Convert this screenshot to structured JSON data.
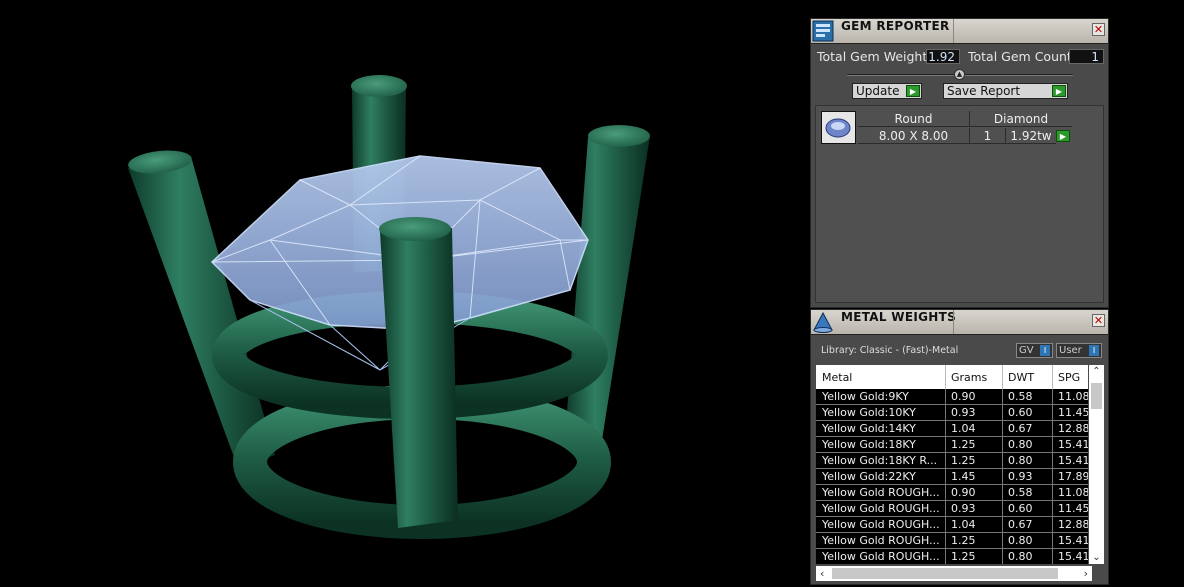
{
  "gem_reporter": {
    "title": "GEM REPORTER",
    "close": "✕",
    "total_weight_label": "Total Gem Weight",
    "total_weight_value": "1.92",
    "total_count_label": "Total Gem Count",
    "total_count_value": "1",
    "update_label": "Update",
    "save_label": "Save Report",
    "gem": {
      "shape": "Round",
      "material": "Diamond",
      "size": "8.00 X 8.00",
      "count": "1",
      "weight": "1.92tw"
    }
  },
  "metal_weights": {
    "title": "METAL WEIGHTS",
    "close": "✕",
    "library": "Library: Classic - (Fast)-Metal",
    "toggle_gv": "GV",
    "toggle_user": "User",
    "columns": [
      "Metal",
      "Grams",
      "DWT",
      "SPG"
    ],
    "rows": [
      [
        "Yellow Gold:9KY",
        "0.90",
        "0.58",
        "11.08"
      ],
      [
        "Yellow Gold:10KY",
        "0.93",
        "0.60",
        "11.45"
      ],
      [
        "Yellow Gold:14KY",
        "1.04",
        "0.67",
        "12.88"
      ],
      [
        "Yellow Gold:18KY",
        "1.25",
        "0.80",
        "15.41"
      ],
      [
        "Yellow Gold:18KY R...",
        "1.25",
        "0.80",
        "15.41"
      ],
      [
        "Yellow Gold:22KY",
        "1.45",
        "0.93",
        "17.89"
      ],
      [
        "Yellow Gold ROUGH...",
        "0.90",
        "0.58",
        "11.08"
      ],
      [
        "Yellow Gold ROUGH...",
        "0.93",
        "0.60",
        "11.45"
      ],
      [
        "Yellow Gold ROUGH...",
        "1.04",
        "0.67",
        "12.88"
      ],
      [
        "Yellow Gold ROUGH...",
        "1.25",
        "0.80",
        "15.41"
      ],
      [
        "Yellow Gold ROUGH...",
        "1.25",
        "0.80",
        "15.41"
      ]
    ]
  }
}
